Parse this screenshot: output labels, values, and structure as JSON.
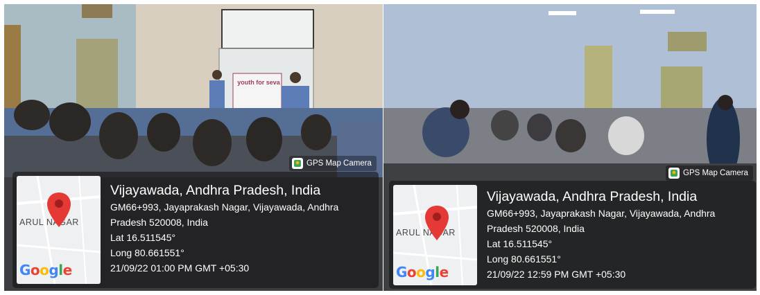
{
  "photos": [
    {
      "badge": "GPS Map Camera",
      "map": {
        "area_label": "ARUL NAGAR",
        "logo": "Google",
        "pin_icon": "map-pin-icon"
      },
      "location_title": "Vijayawada, Andhra Pradesh, India",
      "address_line1": "GM66+993, Jayaprakash Nagar, Vijayawada, Andhra",
      "address_line2": "Pradesh 520008, India",
      "latitude": "Lat 16.511545°",
      "longitude": "Long 80.661551°",
      "timestamp": "21/09/22 01:00 PM GMT +05:30"
    },
    {
      "badge": "GPS Map Camera",
      "map": {
        "area_label": "ARUL NAGAR",
        "logo": "Google",
        "pin_icon": "map-pin-icon"
      },
      "location_title": "Vijayawada, Andhra Pradesh, India",
      "address_line1": "GM66+993, Jayaprakash Nagar, Vijayawada, Andhra",
      "address_line2": "Pradesh 520008, India",
      "latitude": "Lat 16.511545°",
      "longitude": "Long 80.661551°",
      "timestamp": "21/09/22 12:59 PM GMT +05:30"
    }
  ],
  "banner": {
    "text": "youth for seva"
  },
  "colors": {
    "pin": "#E53935",
    "overlay": "#121212",
    "badge_text": "#ffffff"
  }
}
